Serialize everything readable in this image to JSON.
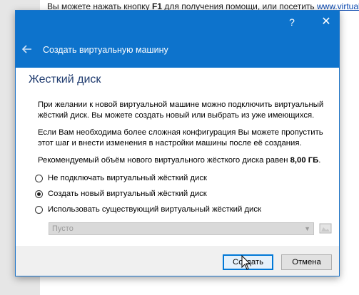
{
  "background": {
    "text_before": "Вы можете нажать кнопку ",
    "text_key": "F1",
    "text_after": " для получения помощи, или посетить ",
    "link": "www.virtualbox"
  },
  "titlebar": {
    "help": "?",
    "close": "✕"
  },
  "header": {
    "back_icon": "arrow-left-icon",
    "title": "Создать виртуальную машину"
  },
  "page": {
    "title": "Жесткий диск",
    "paragraph1": "При желании к новой виртуальной машине можно подключить виртуальный жёсткий диск. Вы можете создать новый или выбрать из уже имеющихся.",
    "paragraph2": "Если Вам необходима более сложная конфигурация Вы можете пропустить этот шаг и внести изменения в настройки машины после её создания.",
    "paragraph3_text": "Рекомендуемый объём нового виртуального жёсткого диска равен ",
    "paragraph3_size": "8,00 ГБ",
    "paragraph3_end": "."
  },
  "options": [
    {
      "label": "Не подключать виртуальный жёсткий диск",
      "checked": false
    },
    {
      "label": "Создать новый виртуальный жёсткий диск",
      "checked": true
    },
    {
      "label": "Использовать существующий виртуальный жёсткий диск",
      "checked": false
    }
  ],
  "combo": {
    "value": "Пусто",
    "enabled": false
  },
  "buttons": {
    "create": "Создать",
    "cancel": "Отмена"
  },
  "colors": {
    "accent": "#0d73cc",
    "header_text": "#ffffff",
    "page_title": "#1e3a6e"
  }
}
